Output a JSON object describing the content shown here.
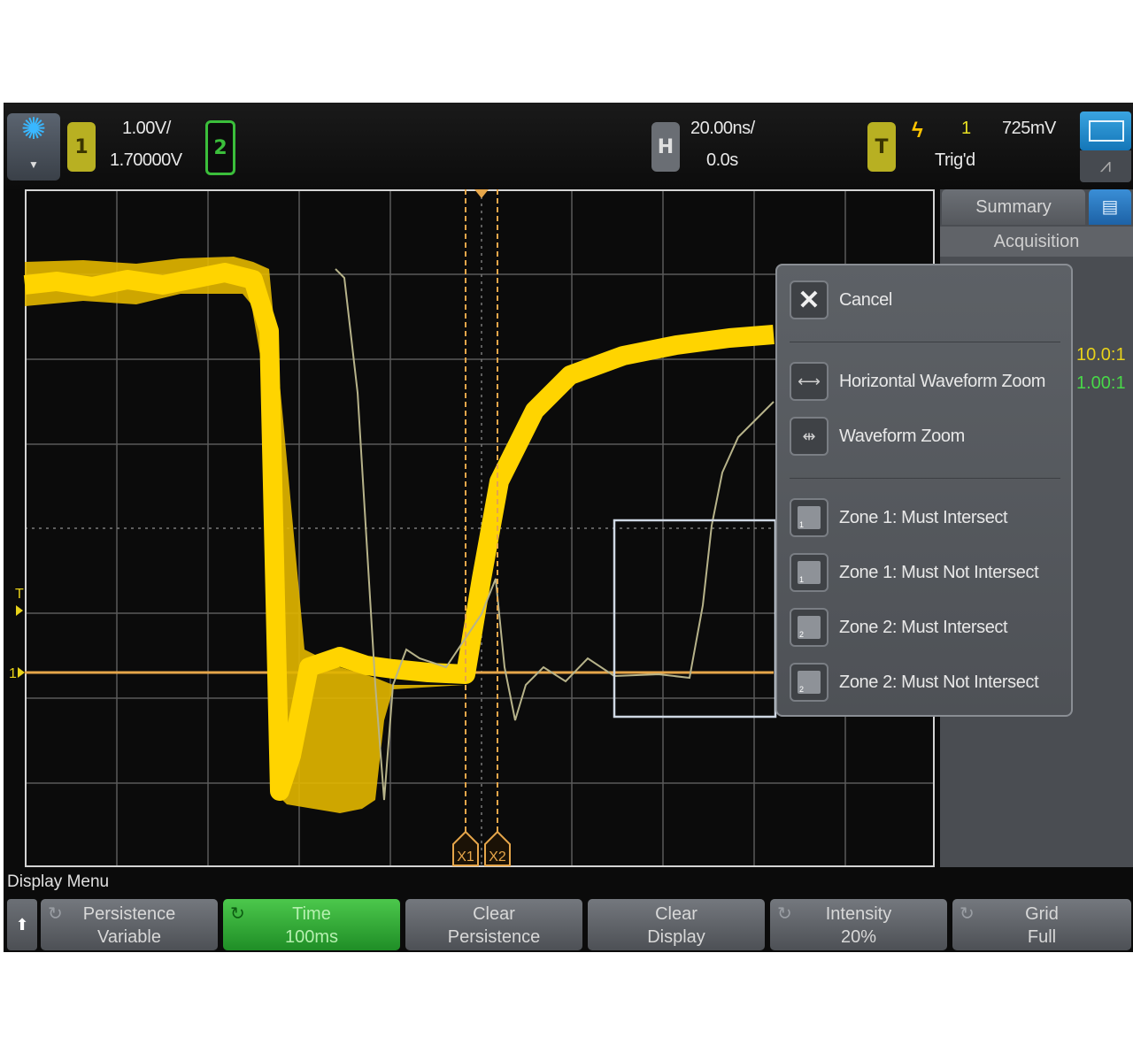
{
  "topbar": {
    "channel1_label": "1",
    "channel1_scale": "1.00V/",
    "channel1_offset": "1.70000V",
    "channel2_label": "2",
    "horizontal_label": "H",
    "time_scale": "20.00ns/",
    "time_delay": "0.0s",
    "trigger_label": "T",
    "trigger_source": "1",
    "trigger_level": "725mV",
    "trigger_status": "Trig'd"
  },
  "sidebar": {
    "tab_summary": "Summary",
    "row_acquisition": "Acquisition",
    "probe_ratio_1": "10.0:1",
    "probe_ratio_2": "1.00:1",
    "colors": {
      "ratio_1": "#e8d21a",
      "ratio_2": "#48d848"
    }
  },
  "markers": {
    "trigger_level_marker": "T",
    "ground_marker": "1",
    "cursor_x1": "X1",
    "cursor_x2": "X2"
  },
  "popup_menu": {
    "items": [
      {
        "label": "Cancel"
      },
      {
        "label": "Horizontal Waveform Zoom"
      },
      {
        "label": "Waveform Zoom"
      },
      {
        "label": "Zone 1: Must Intersect"
      },
      {
        "label": "Zone 1: Must Not Intersect"
      },
      {
        "label": "Zone 2: Must Intersect"
      },
      {
        "label": "Zone 2: Must Not Intersect"
      }
    ]
  },
  "bottom_menu": {
    "title": "Display Menu",
    "softkeys": [
      {
        "line1": "Persistence",
        "line2": "Variable"
      },
      {
        "line1": "Time",
        "line2": "100ms",
        "active": true
      },
      {
        "line1": "Clear",
        "line2": "Persistence"
      },
      {
        "line1": "Clear",
        "line2": "Display"
      },
      {
        "line1": "Intensity",
        "line2": "20%"
      },
      {
        "line1": "Grid",
        "line2": "Full"
      }
    ]
  },
  "colors": {
    "channel1_waveform": "#ffd400",
    "cursor": "#e6a64a",
    "active_softkey": "#2ea832",
    "channel2": "#3bbf3b"
  }
}
